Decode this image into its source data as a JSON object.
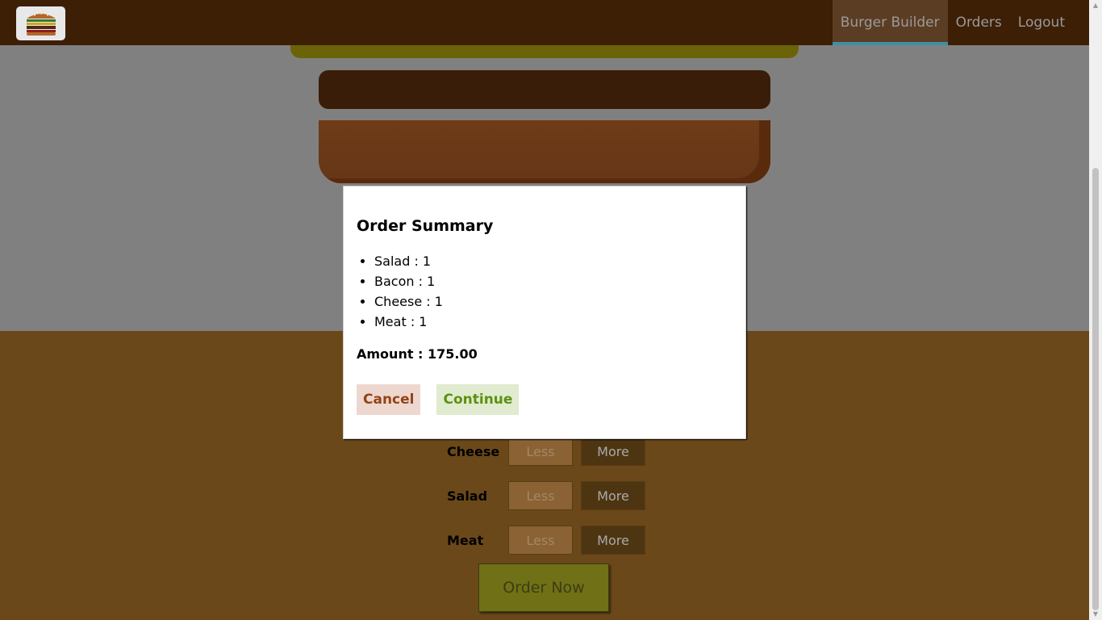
{
  "header": {
    "nav": [
      {
        "label": "Burger Builder",
        "active": true
      },
      {
        "label": "Orders",
        "active": false
      },
      {
        "label": "Logout",
        "active": false
      }
    ]
  },
  "controls": {
    "rows": [
      {
        "label": "Cheese",
        "less": "Less",
        "more": "More"
      },
      {
        "label": "Salad",
        "less": "Less",
        "more": "More"
      },
      {
        "label": "Meat",
        "less": "Less",
        "more": "More"
      }
    ],
    "order_button": "Order Now"
  },
  "modal": {
    "title": "Order Summary",
    "items": [
      "Salad : 1",
      "Bacon : 1",
      "Cheese : 1",
      "Meat : 1"
    ],
    "amount": "Amount : 175.00",
    "cancel_label": "Cancel",
    "continue_label": "Continue"
  },
  "colors": {
    "toolbar": "#3d1f06",
    "cancel_text": "#944317",
    "continue_text": "#5c9210"
  }
}
